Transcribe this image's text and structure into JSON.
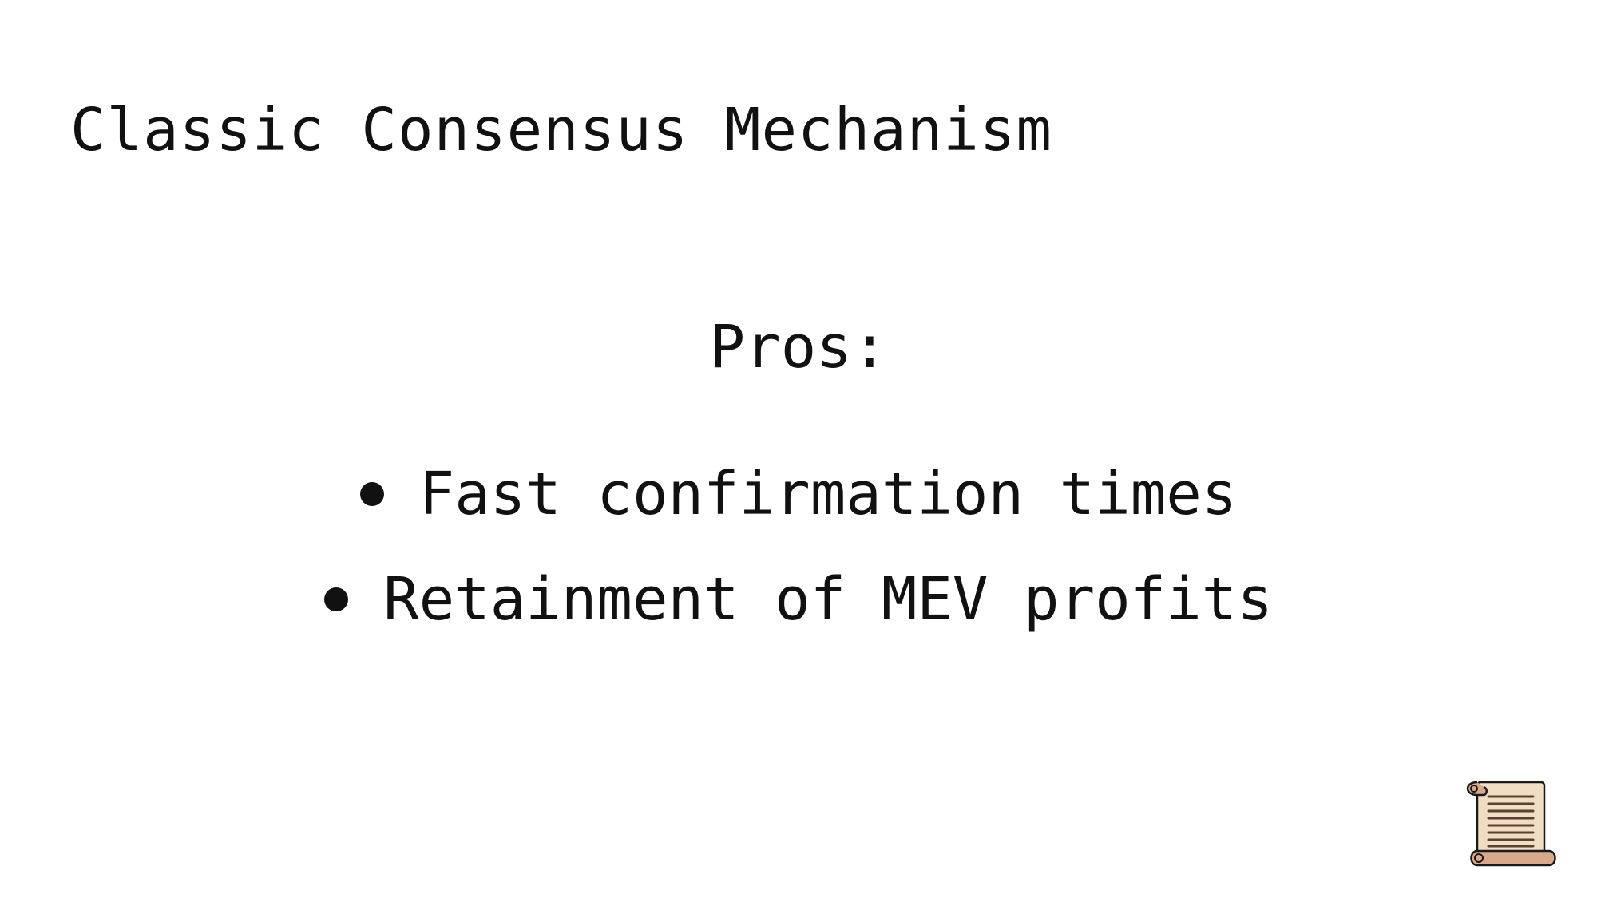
{
  "slide": {
    "title": "Classic Consensus Mechanism",
    "pros_heading": "Pros:",
    "bullets": [
      {
        "text": "Fast confirmation times"
      },
      {
        "text": "Retainment of MEV profits"
      }
    ],
    "icons": {
      "bullet": "bullet-dot-icon",
      "corner": "scroll-icon"
    },
    "colors": {
      "text": "#111111",
      "background": "#ffffff",
      "scroll_paper": "#f1dcc4",
      "scroll_roll": "#d9a98c"
    }
  }
}
